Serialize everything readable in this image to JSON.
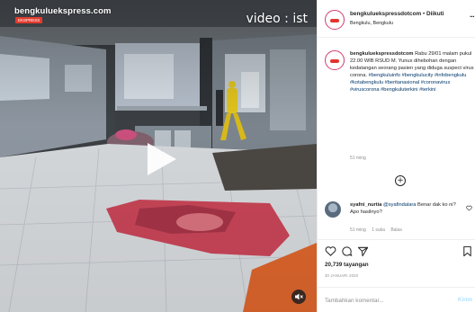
{
  "video": {
    "site_logo": "bengkuluekspress.com",
    "logo_subtitle": "EKSPRESS",
    "watermark": "video : ist",
    "play_icon": "play-icon",
    "mute_icon": "speaker-muted-icon"
  },
  "header": {
    "username": "bengkuluekspressdotcom",
    "separator": "•",
    "follow_label": "Diikuti",
    "location": "Bengkulu, Bengkulu",
    "more_icon": "more-horizontal-icon"
  },
  "caption": {
    "username": "bengkuluekspressdotcom",
    "text": "Rabu 29/01 malam pukul 22.00 WIB RSUD M. Yunus dihebohan dengan kedatangan seorang pasien yang diduga suspect virus corona.",
    "hashtags": "#bengkuluinfo #bengkulucity #infobengkulu #kotabengkulu #beritanasional #coronavirus #viruscorona #bengkuluterkini #terkini",
    "time": "51 ming"
  },
  "load_more_label": "+",
  "comment": {
    "username": "syafni_nurtia",
    "mention": "@syafindalara",
    "text": "Benar dak ko ni? Apo hasilnyo?",
    "time": "51 ming",
    "likes": "1 suka",
    "reply": "Balas"
  },
  "actions": {
    "like_icon": "heart-icon",
    "comment_icon": "comment-bubble-icon",
    "share_icon": "paper-plane-icon",
    "save_icon": "bookmark-icon"
  },
  "stats": {
    "views": "20,739 tayangan",
    "date": "30 JANUARI 2020"
  },
  "add_comment": {
    "placeholder": "Tambahkan komentar...",
    "post_label": "Kirim"
  },
  "colors": {
    "story_ring": "#d33a73",
    "link": "#00376b",
    "muted_text": "#8e8e8e",
    "post_button_disabled": "#b2dffc"
  }
}
